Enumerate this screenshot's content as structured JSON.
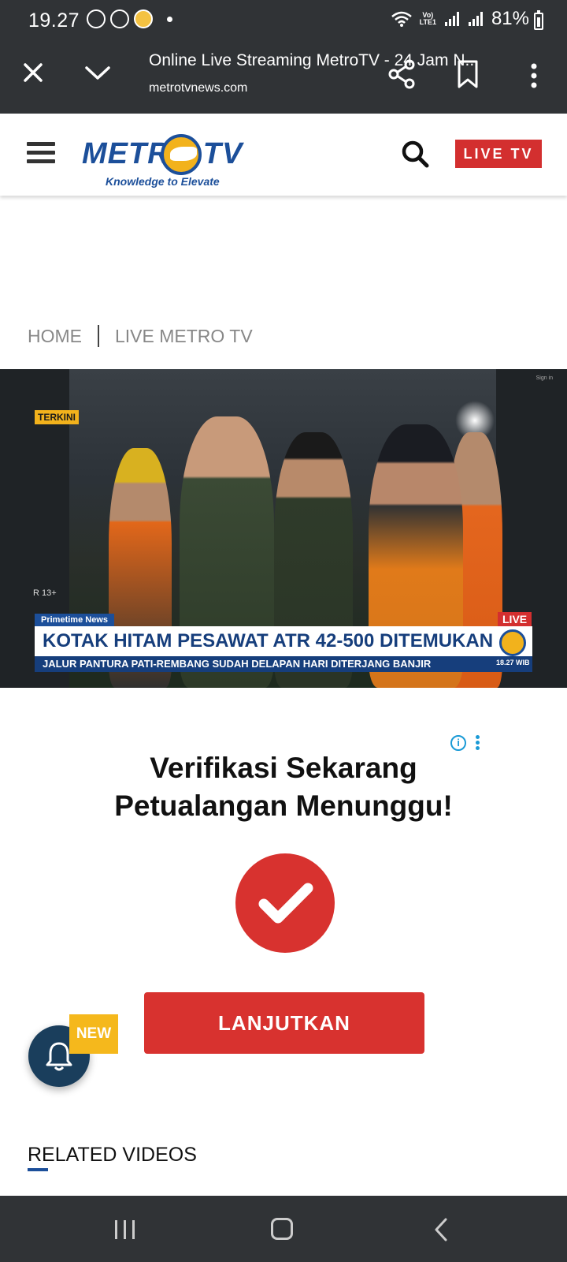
{
  "status_bar": {
    "time": "19.27",
    "lte_label_top": "Vo)",
    "lte_label_bottom": "LTE1",
    "battery": "81%"
  },
  "browser": {
    "page_title": "Online Live Streaming MetroTV - 24 Jam N...",
    "url": "metrotvnews.com"
  },
  "site_header": {
    "logo_text": "METRO TV",
    "tagline": "Knowledge to Elevate",
    "live_button": "LIVE TV"
  },
  "breadcrumb": {
    "items": [
      "HOME",
      "LIVE METRO TV"
    ]
  },
  "video": {
    "tag": "TERKINI",
    "rating": "R 13+",
    "sign_in": "Sign in",
    "program": "Primetime News",
    "live_label": "LIVE",
    "headline": "KOTAK HITAM PESAWAT ATR 42-500 DITEMUKAN",
    "ticker": "JALUR PANTURA PATI-REMBANG SUDAH DELAPAN HARI DITERJANG BANJIR",
    "clock": "18.27 WIB"
  },
  "ad": {
    "heading_line1": "Verifikasi Sekarang",
    "heading_line2": "Petualangan Menunggu!",
    "info_icon": "i",
    "cta": "LANJUTKAN"
  },
  "notification": {
    "badge": "NEW"
  },
  "related": {
    "title": "RELATED VIDEOS"
  },
  "colors": {
    "bars": "#303336",
    "brand_blue": "#1c4f9a",
    "live_red": "#d32f2f",
    "ad_red": "#d8322f",
    "badge_yellow": "#f5b81c"
  }
}
